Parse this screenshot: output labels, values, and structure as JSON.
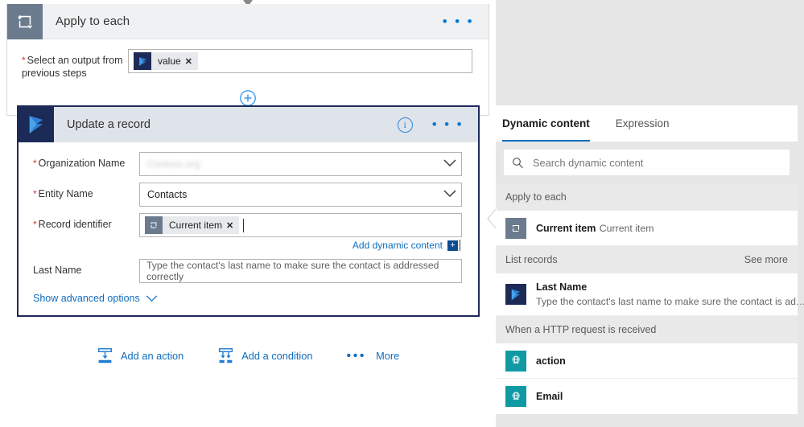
{
  "designer": {
    "scope": {
      "icon": "loop-icon",
      "title": "Apply to each",
      "menu_label": "• • •",
      "field": {
        "label": "Select an output from previous steps",
        "required": true,
        "token": {
          "icon": "dynamics365-icon",
          "label": "value",
          "remove_label": "✕"
        }
      },
      "add_step_label": "+"
    },
    "action": {
      "icon": "dynamics365-icon",
      "title": "Update a record",
      "info_label": "i",
      "menu_label": "• • •",
      "fields": [
        {
          "label": "Organization Name",
          "required": true,
          "type": "select",
          "value": "Contoso org",
          "blurred": true
        },
        {
          "label": "Entity Name",
          "required": true,
          "type": "select",
          "value": "Contacts",
          "blurred": false
        },
        {
          "label": "Record identifier",
          "required": true,
          "type": "token",
          "token": {
            "icon": "loop-icon",
            "label": "Current item",
            "remove_label": "✕"
          }
        },
        {
          "label": "Last Name",
          "required": false,
          "type": "text",
          "value": "Type the contact's last name to make sure the contact is addressed correctly"
        }
      ],
      "add_dynamic_content": {
        "label": "Add dynamic content",
        "plus_label": "+"
      },
      "advanced_options": {
        "label": "Show advanced options",
        "chevron": "chevron-down-icon"
      }
    },
    "bottom_bar": [
      {
        "id": "add-an-action",
        "icon": "add-action-icon",
        "label": "Add an action"
      },
      {
        "id": "add-a-condition",
        "icon": "add-condition-icon",
        "label": "Add a condition"
      },
      {
        "id": "more",
        "icon": "ellipsis-icon",
        "label": "More"
      }
    ]
  },
  "flyout": {
    "tabs": [
      {
        "label": "Dynamic content",
        "active": true
      },
      {
        "label": "Expression",
        "active": false
      }
    ],
    "search": {
      "icon": "search-icon",
      "placeholder": "Search dynamic content",
      "value": ""
    },
    "groups": [
      {
        "name": "Apply to each",
        "see_more": "",
        "items": [
          {
            "icon": "loop-icon",
            "icon_color": "#6b7a8d",
            "title": "Current item",
            "subtitle": "Current item"
          }
        ]
      },
      {
        "name": "List records",
        "see_more": "See more",
        "items": [
          {
            "icon": "dynamics365-icon",
            "icon_color": "#1b2a57",
            "title": "Last Name",
            "subtitle": "Type the contact's last name to make sure the contact is ad…"
          }
        ]
      },
      {
        "name": "When a HTTP request is received",
        "see_more": "",
        "items": [
          {
            "icon": "globe-icon",
            "icon_color": "#0f9aa3",
            "title": "action",
            "subtitle": ""
          },
          {
            "icon": "globe-icon",
            "icon_color": "#0f9aa3",
            "title": "Email",
            "subtitle": ""
          }
        ]
      }
    ]
  },
  "colors": {
    "accent_blue": "#0f6cbd",
    "link_blue": "#2b88d8",
    "dynamics_navy": "#1b2a57",
    "scope_slate": "#6b7a8d",
    "http_teal": "#0f9aa3",
    "required_red": "#d13438",
    "selected_border": "#1f2a5b",
    "page_bg": "#e6e6e6"
  }
}
